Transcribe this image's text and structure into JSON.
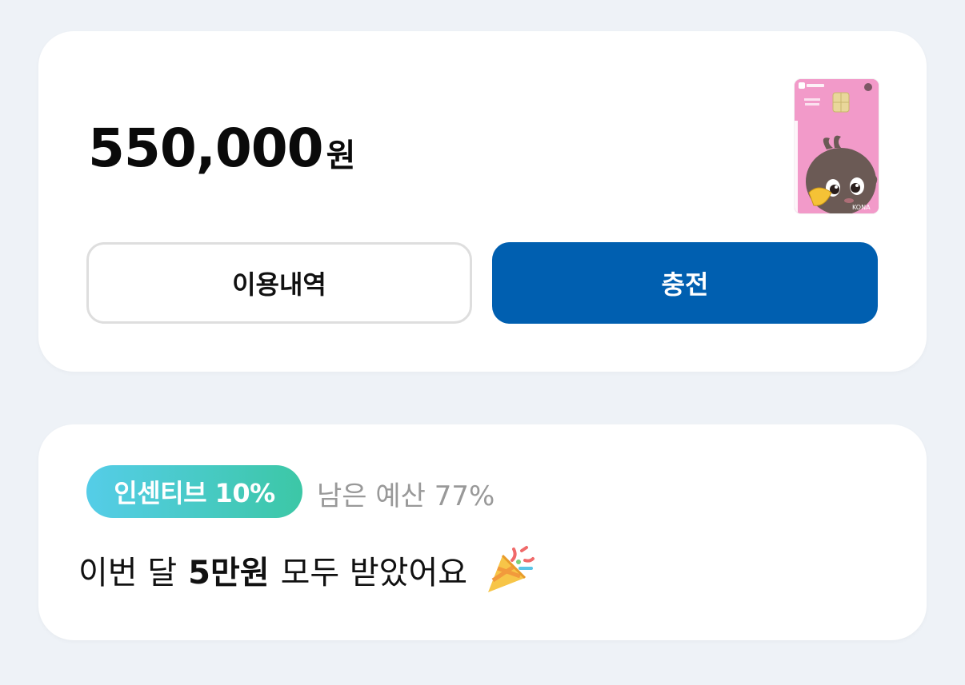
{
  "balance": {
    "amount": "550,000",
    "unit": "원"
  },
  "local_card": {
    "icon": "local-currency-card-image",
    "brand": "KONA",
    "color": "#f29ac9"
  },
  "buttons": {
    "history_label": "이용내역",
    "charge_label": "충전",
    "charge_color": "#005fb0"
  },
  "incentive": {
    "badge_label": "인센티브 10%",
    "budget_label": "남은 예산 77%",
    "message_prefix": "이번 달",
    "message_amount": "5만원",
    "message_suffix": "모두 받았어요",
    "celebration_icon": "party-popper-icon"
  },
  "colors": {
    "background": "#eef2f7",
    "badge_gradient_start": "#55cde8",
    "badge_gradient_end": "#3cc7a6"
  }
}
